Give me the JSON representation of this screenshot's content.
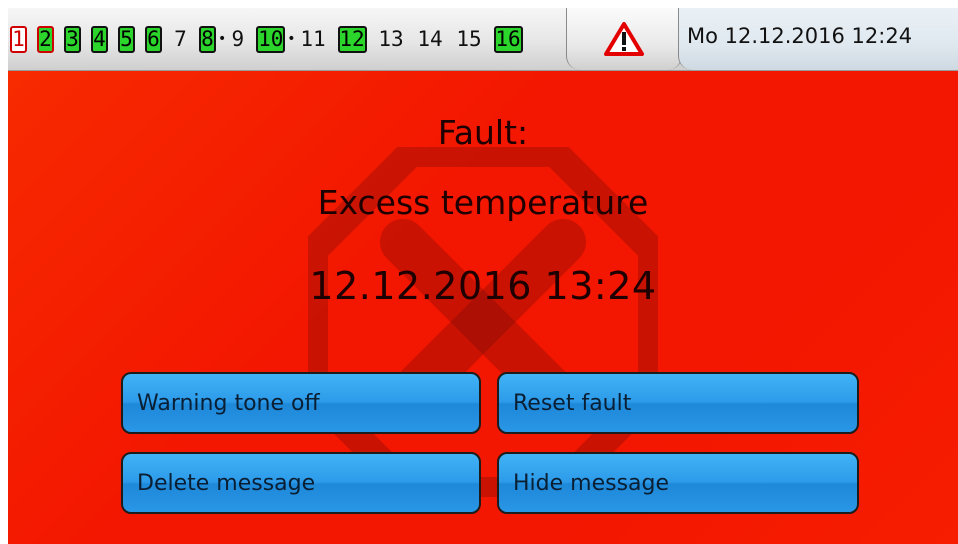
{
  "status_bar": {
    "outputs": [
      {
        "label": "1",
        "state": "off-manual"
      },
      {
        "label": "2",
        "state": "on-manual"
      },
      {
        "label": "3",
        "state": "on-auto"
      },
      {
        "label": "4",
        "state": "on-auto"
      },
      {
        "label": "5",
        "state": "on-auto"
      },
      {
        "label": "6",
        "state": "on-auto"
      },
      {
        "label": "7",
        "state": "off-auto"
      },
      {
        "label": "8",
        "state": "on-auto",
        "linked": true
      },
      {
        "label": "9",
        "state": "off-auto"
      },
      {
        "label": "10",
        "state": "on-auto",
        "linked": true
      },
      {
        "label": "11",
        "state": "off-auto"
      },
      {
        "label": "12",
        "state": "on-auto"
      },
      {
        "label": "13",
        "state": "off-auto"
      },
      {
        "label": "14",
        "state": "off-auto"
      },
      {
        "label": "15",
        "state": "off-auto"
      },
      {
        "label": "16",
        "state": "on-auto"
      }
    ],
    "warning_icon": "warning-triangle-icon",
    "datetime": "Mo 12.12.2016  12:24"
  },
  "fault": {
    "title": "Fault:",
    "name": "Excess temperature",
    "time": "12.12.2016  13:24",
    "background_icon": "stop-x-icon",
    "background_color": "#f31600"
  },
  "buttons": {
    "warning_tone_off": "Warning tone off",
    "reset_fault": "Reset fault",
    "delete_message": "Delete message",
    "hide_message": "Hide message"
  },
  "colors": {
    "output_on": "#2bd52b",
    "manual_border": "#d00000",
    "button_blue": "#2d9be9",
    "warning_red": "#e30000"
  }
}
